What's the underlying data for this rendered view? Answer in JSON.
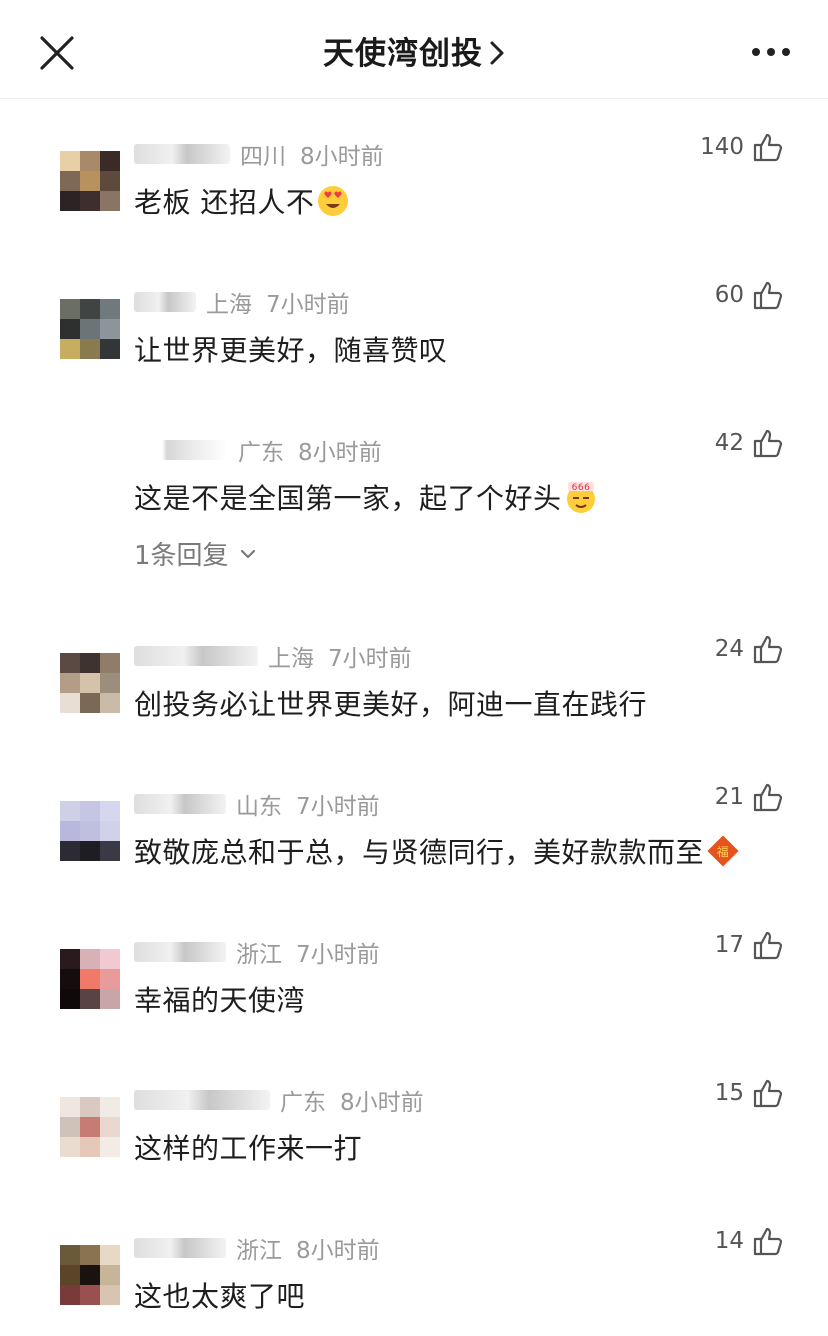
{
  "header": {
    "title": "天使湾创投",
    "close_icon": "close-icon",
    "more_icon": "more-icon"
  },
  "comments": [
    {
      "region": "四川",
      "time": "8小时前",
      "text": "老板 还招人不",
      "emoji": "heart-eyes-emoji",
      "likes": "140"
    },
    {
      "region": "上海",
      "time": "7小时前",
      "text": "让世界更美好，随喜赞叹",
      "likes": "60"
    },
    {
      "region": "广东",
      "time": "8小时前",
      "text": "这是不是全国第一家，起了个好头",
      "emoji": "666-emoji",
      "likes": "42",
      "replies": "1条回复"
    },
    {
      "region": "上海",
      "time": "7小时前",
      "text": "创投务必让世界更美好，阿迪一直在践行",
      "likes": "24"
    },
    {
      "region": "山东",
      "time": "7小时前",
      "text": "致敬庞总和于总，与贤德同行，美好款款而至",
      "emoji": "fu-emoji",
      "likes": "21"
    },
    {
      "region": "浙江",
      "time": "7小时前",
      "text": "幸福的天使湾",
      "likes": "17"
    },
    {
      "region": "广东",
      "time": "8小时前",
      "text": "这样的工作来一打",
      "likes": "15"
    },
    {
      "region": "浙江",
      "time": "8小时前",
      "text": "这也太爽了吧",
      "likes": "14"
    }
  ],
  "colors": {
    "meta_text": "#9a9a9a",
    "body_text": "#1e1e1e",
    "divider": "#ececec"
  }
}
